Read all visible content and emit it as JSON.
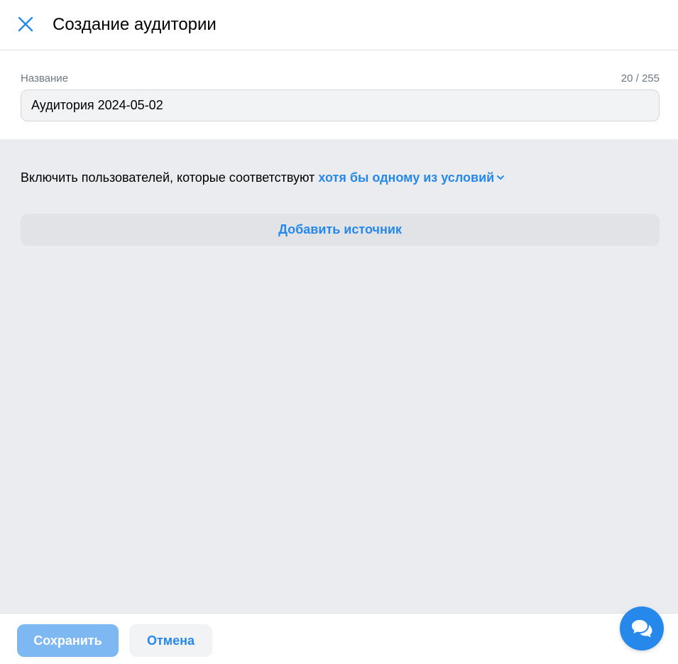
{
  "header": {
    "close_icon": "close-icon",
    "title": "Создание аудитории"
  },
  "name_field": {
    "label": "Название",
    "counter": "20 / 255",
    "value": "Аудитория 2024-05-02"
  },
  "conditions": {
    "text": "Включить пользователей, которые соответствуют ",
    "match_mode": "хотя бы одному из условий",
    "match_icon": "chevron-down-icon",
    "add_source_label": "Добавить источник"
  },
  "footer": {
    "save_label": "Сохранить",
    "cancel_label": "Отмена"
  },
  "chat_widget": {
    "icon": "chat-bubbles-icon"
  },
  "colors": {
    "accent": "#2688eb",
    "save_disabled": "#7db8f2",
    "section_bg": "#ebecf0"
  }
}
